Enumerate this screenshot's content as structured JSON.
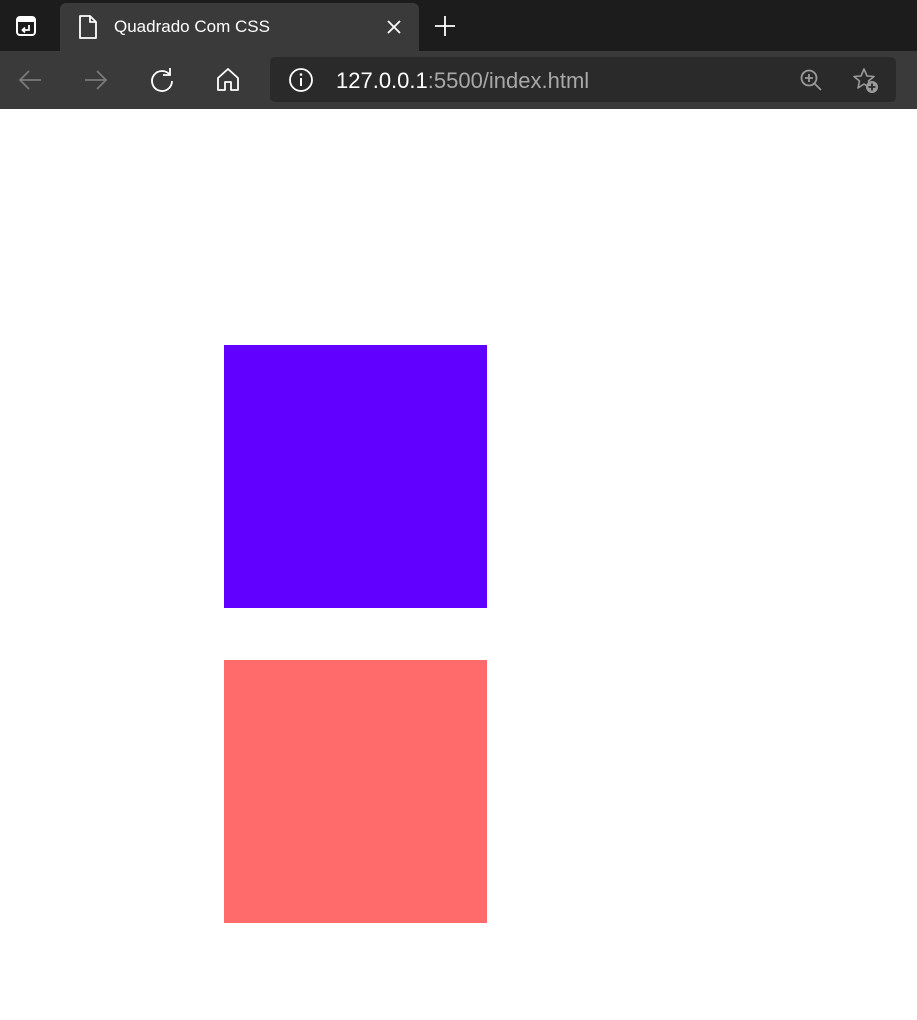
{
  "browser": {
    "tab": {
      "title": "Quadrado Com CSS",
      "icon": "page-icon"
    },
    "toolbar": {
      "icons": [
        "back-arrow-icon",
        "forward-arrow-icon",
        "reload-icon",
        "home-icon"
      ]
    },
    "address": {
      "host": "127.0.0.1",
      "rest": ":5500/index.html",
      "icons": [
        "info-icon",
        "zoom-icon",
        "favorite-add-icon"
      ]
    }
  },
  "page": {
    "squares": [
      {
        "name": "purple-square",
        "color": "#6200FF"
      },
      {
        "name": "coral-square",
        "color": "#FF6B6B"
      }
    ]
  },
  "colors": {
    "tabbar_bg": "#1c1c1c",
    "toolbar_bg": "#3a3a3a",
    "addressbar_bg": "#2a2a2a"
  }
}
